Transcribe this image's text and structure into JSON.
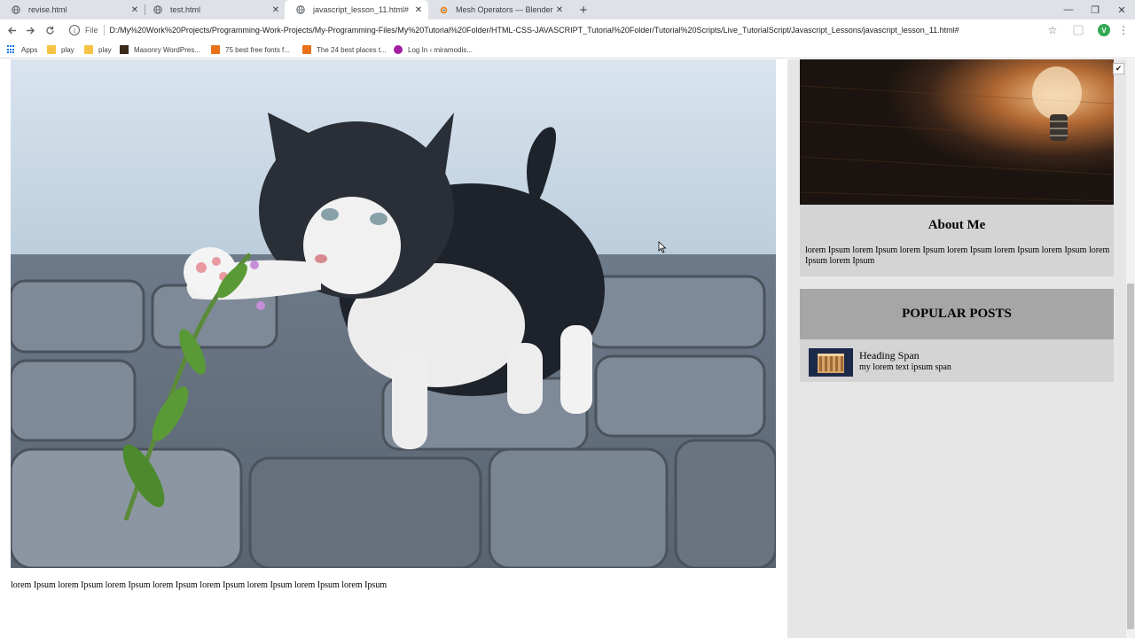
{
  "browser": {
    "tabs": [
      {
        "title": "revise.html",
        "active": false,
        "icon": "globe-icon"
      },
      {
        "title": "test.html",
        "active": false,
        "icon": "globe-icon"
      },
      {
        "title": "javascript_lesson_11.html#",
        "active": true,
        "icon": "globe-icon"
      },
      {
        "title": "Mesh Operators — Blender Pyth",
        "active": false,
        "icon": "blender-icon"
      }
    ],
    "new_tab_icon": "plus-icon",
    "window_controls": {
      "minimize": "—",
      "restore": "❐",
      "close": "✕"
    },
    "scheme_label": "File",
    "url": "D:/My%20Work%20Projects/Programming-Work-Projects/My-Programming-Files/My%20Tutorial%20Folder/HTML-CSS-JAVASCRIPT_Tutorial%20Folder/Tutorial%20Scripts/Live_TutorialScript/Javascript_Lessons/javascript_lesson_11.html#",
    "profile_initial": "V",
    "bookmarks": [
      {
        "label": "Apps",
        "icon": "apps-grid-icon"
      },
      {
        "label": "play",
        "icon": "folder-icon"
      },
      {
        "label": "play",
        "icon": "folder-icon"
      },
      {
        "label": "Masonry WordPres...",
        "icon": "site-icon"
      },
      {
        "label": "75 best free fonts f...",
        "icon": "site-icon"
      },
      {
        "label": "The 24 best places t...",
        "icon": "site-icon"
      },
      {
        "label": "Log In ‹ miramodis...",
        "icon": "site-icon"
      }
    ]
  },
  "page": {
    "main": {
      "image_alt": "kitten",
      "caption": "lorem Ipsum lorem Ipsum lorem Ipsum lorem Ipsum lorem Ipsum lorem Ipsum lorem Ipsum lorem Ipsum"
    },
    "sidebar": {
      "about": {
        "title": "About Me",
        "text": "lorem Ipsum lorem Ipsum lorem Ipsum lorem Ipsum lorem Ipsum lorem Ipsum lorem Ipsum lorem Ipsum"
      },
      "popular": {
        "title": "POPULAR POSTS",
        "items": [
          {
            "title": "Heading Span",
            "text": "my lorem text ipsum span"
          }
        ]
      }
    }
  },
  "colors": {
    "tabstrip": "#dee1e6",
    "sidebar_bg": "#e6e6e6",
    "card_bg": "#d4d4d4",
    "popular_header_bg": "#a6a6a6"
  }
}
